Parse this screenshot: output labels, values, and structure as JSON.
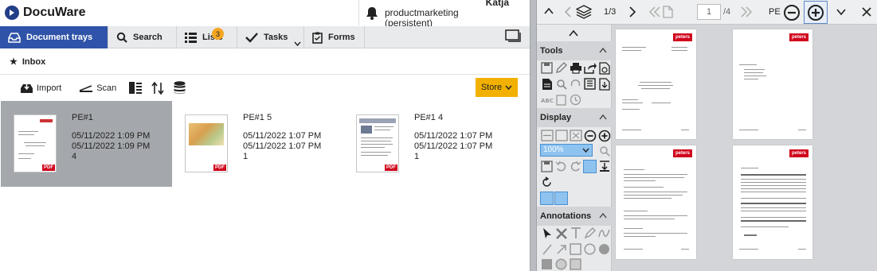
{
  "app": {
    "name": "DocuWare"
  },
  "user": {
    "name": "Katja",
    "role": "productmarketing (persistent)"
  },
  "nav": {
    "tabs": [
      {
        "label": "Document trays"
      },
      {
        "label": "Search"
      },
      {
        "label": "Lists",
        "badge": "3"
      },
      {
        "label": "Tasks"
      },
      {
        "label": "Forms"
      }
    ]
  },
  "tray": {
    "title": "Inbox"
  },
  "toolbar": {
    "import_label": "Import",
    "scan_label": "Scan",
    "store_label": "Store"
  },
  "documents": [
    {
      "name": "PE#1",
      "date1": "05/11/2022 1:09 PM",
      "date2": "05/11/2022 1:09 PM",
      "count": "4",
      "tag": "PDF"
    },
    {
      "name": "PE#1 5",
      "date1": "05/11/2022 1:07 PM",
      "date2": "05/11/2022 1:07 PM",
      "count": "1",
      "tag": "PDF"
    },
    {
      "name": "PE#1 4",
      "date1": "05/11/2022 1:07 PM",
      "date2": "05/11/2022 1:07 PM",
      "count": "1",
      "tag": "PDF"
    }
  ],
  "viewer": {
    "doc_pos": "1/3",
    "page_value": "1",
    "page_total": "/4",
    "doc_name": "PE",
    "zoom": "100%",
    "page_logo": "peters"
  },
  "panel": {
    "tools": "Tools",
    "display": "Display",
    "annotations": "Annotations"
  },
  "colors": {
    "accent": "#2f53a8",
    "store": "#f2b100",
    "pdf": "#d0021b",
    "badge": "#f5a623"
  }
}
